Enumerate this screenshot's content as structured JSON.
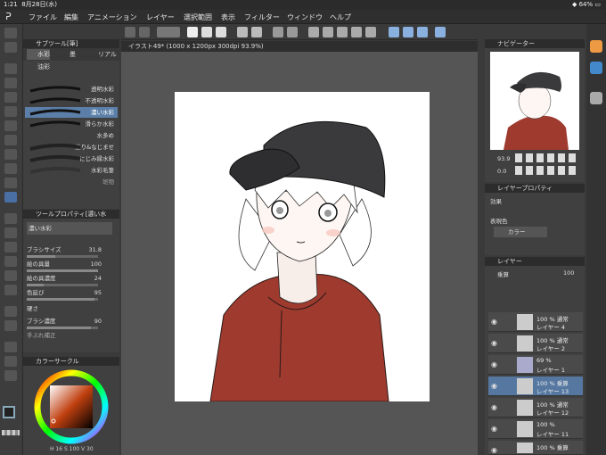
{
  "status": {
    "time": "1:21",
    "date": "8月28日(水)",
    "battery": "64%"
  },
  "menu": [
    "ファイル",
    "編集",
    "アニメーション",
    "レイヤー",
    "選択範囲",
    "表示",
    "フィルター",
    "ウィンドウ",
    "ヘルプ"
  ],
  "subtool": {
    "title": "サブツール[筆]",
    "tabs": [
      "水彩",
      "墨",
      "リアル",
      "油彩"
    ],
    "brushes": [
      "透明水彩",
      "不透明水彩",
      "濃い水彩",
      "滑らか水彩",
      "水多め",
      "塗り&なじませ",
      "にじみ縁水彩",
      "水彩毛筆",
      "斑物"
    ]
  },
  "toolprop": {
    "title": "ツールプロパティ[濃い水",
    "brush_name": "濃い水彩",
    "rows": [
      {
        "label": "ブラシサイズ",
        "value": "31.8"
      },
      {
        "label": "絵の具量",
        "value": "100"
      },
      {
        "label": "絵の具濃度",
        "value": "24"
      },
      {
        "label": "色延び",
        "value": "95"
      },
      {
        "label": "硬さ",
        "value": ""
      },
      {
        "label": "ブラシ濃度",
        "value": "90"
      },
      {
        "label": "手ぶれ補正",
        "value": ""
      }
    ]
  },
  "colorcircle": {
    "title": "カラーサークル",
    "readout": "H 16 S 100 V 30"
  },
  "canvas": {
    "doc_title": "イラスト49* (1000 x 1200px 300dpi 93.9%)"
  },
  "navigator": {
    "title": "ナビゲーター",
    "zoom": "93.9",
    "rotate": "0.0"
  },
  "layerprop": {
    "title": "レイヤープロパティ",
    "effect_label": "効果",
    "express_label": "表現色",
    "express_value": "カラー"
  },
  "layers": {
    "title": "レイヤー",
    "blend": "乗算",
    "opacity": "100",
    "items": [
      {
        "pct": "100 % 通常",
        "name": "レイヤー 4"
      },
      {
        "pct": "100 % 通常",
        "name": "レイヤー 2"
      },
      {
        "pct": "69 %",
        "name": "レイヤー 1"
      },
      {
        "pct": "100 % 乗算",
        "name": "レイヤー 13"
      },
      {
        "pct": "100 % 通常",
        "name": "レイヤー 12"
      },
      {
        "pct": "100 %",
        "name": "レイヤー 11"
      },
      {
        "pct": "100 % 乗算",
        "name": ""
      }
    ]
  },
  "colors": {
    "accent": "#5577a0",
    "hoodie": "#9e3a2e",
    "cap": "#3a3a3c"
  }
}
